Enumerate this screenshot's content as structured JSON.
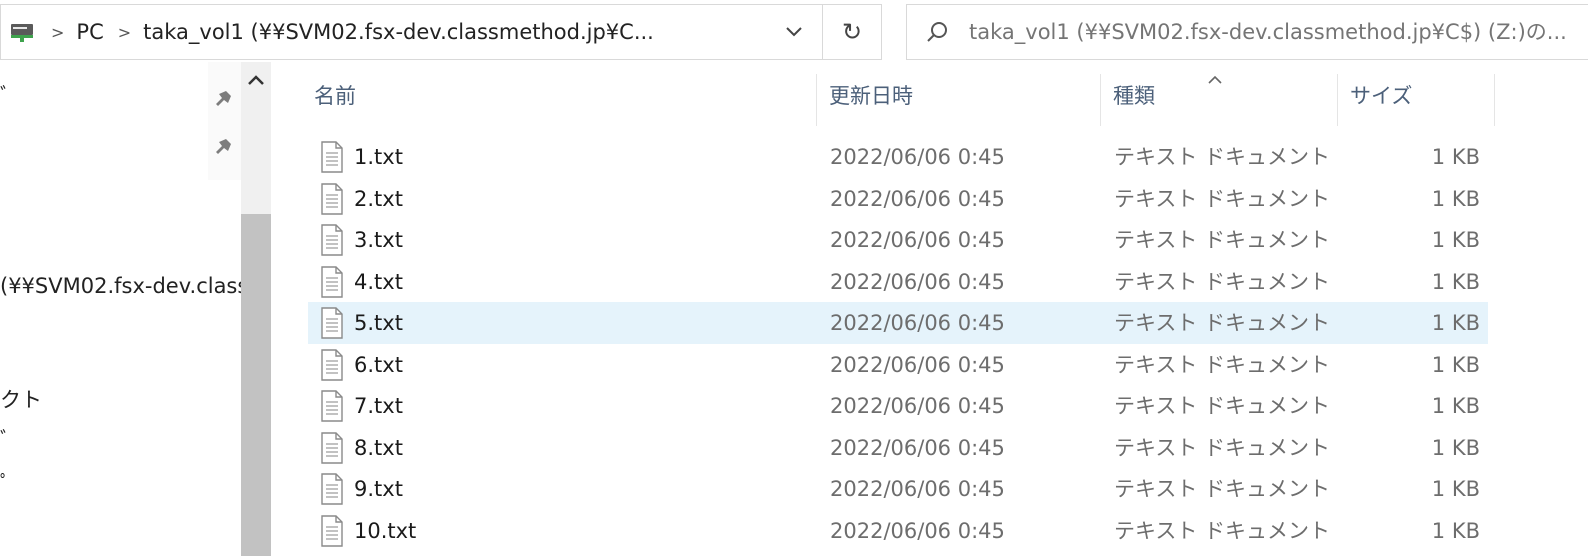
{
  "address_bar": {
    "breadcrumbs": [
      "PC",
      "taka_vol1 (¥¥SVM02.fsx-dev.classmethod.jp¥C..."
    ]
  },
  "search": {
    "placeholder": "taka_vol1 (¥¥SVM02.fsx-dev.classmethod.jp¥C$) (Z:)の..."
  },
  "nav_pane": {
    "fragments": [
      "ﾞ",
      "(¥¥SVM02.fsx-dev.class",
      "クト",
      "ﾞ",
      "ﾟ"
    ]
  },
  "columns": {
    "name": "名前",
    "date": "更新日時",
    "type": "種類",
    "size": "サイズ"
  },
  "files": [
    {
      "name": "1.txt",
      "date": "2022/06/06 0:45",
      "type": "テキスト ドキュメント",
      "size": "1 KB"
    },
    {
      "name": "2.txt",
      "date": "2022/06/06 0:45",
      "type": "テキスト ドキュメント",
      "size": "1 KB"
    },
    {
      "name": "3.txt",
      "date": "2022/06/06 0:45",
      "type": "テキスト ドキュメント",
      "size": "1 KB"
    },
    {
      "name": "4.txt",
      "date": "2022/06/06 0:45",
      "type": "テキスト ドキュメント",
      "size": "1 KB"
    },
    {
      "name": "5.txt",
      "date": "2022/06/06 0:45",
      "type": "テキスト ドキュメント",
      "size": "1 KB"
    },
    {
      "name": "6.txt",
      "date": "2022/06/06 0:45",
      "type": "テキスト ドキュメント",
      "size": "1 KB"
    },
    {
      "name": "7.txt",
      "date": "2022/06/06 0:45",
      "type": "テキスト ドキュメント",
      "size": "1 KB"
    },
    {
      "name": "8.txt",
      "date": "2022/06/06 0:45",
      "type": "テキスト ドキュメント",
      "size": "1 KB"
    },
    {
      "name": "9.txt",
      "date": "2022/06/06 0:45",
      "type": "テキスト ドキュメント",
      "size": "1 KB"
    },
    {
      "name": "10.txt",
      "date": "2022/06/06 0:45",
      "type": "テキスト ドキュメント",
      "size": "1 KB"
    }
  ],
  "colors": {
    "header_text": "#4c607a",
    "hover_row": "#e5f3fb",
    "border": "#d9d9d9"
  }
}
